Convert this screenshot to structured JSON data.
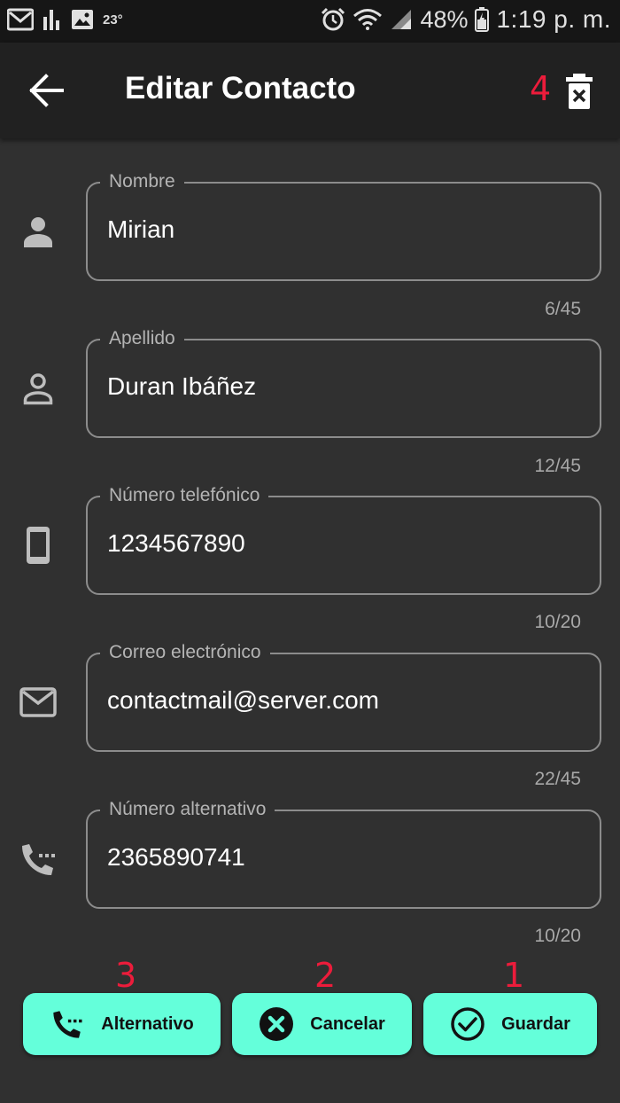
{
  "status_bar": {
    "temperature": "23°",
    "battery": "48%",
    "time": "1:19 p. m."
  },
  "app_bar": {
    "title": "Editar Contacto",
    "delete_annotation": "4"
  },
  "fields": [
    {
      "icon": "person-icon",
      "label": "Nombre",
      "value": "Mirian",
      "counter": "6/45"
    },
    {
      "icon": "person-outline-icon",
      "label": "Apellido",
      "value": "Duran Ibáñez",
      "counter": "12/45"
    },
    {
      "icon": "smartphone-icon",
      "label": "Número telefónico",
      "value": "1234567890",
      "counter": "10/20"
    },
    {
      "icon": "mail-icon",
      "label": "Correo electrónico",
      "value": "contactmail@server.com",
      "counter": "22/45"
    },
    {
      "icon": "dialpad-phone-icon",
      "label": "Número alternativo",
      "value": "2365890741",
      "counter": "10/20"
    }
  ],
  "actions": {
    "alternativo": {
      "label": "Alternativo",
      "annotation": "3"
    },
    "cancelar": {
      "label": "Cancelar",
      "annotation": "2"
    },
    "guardar": {
      "label": "Guardar",
      "annotation": "1"
    }
  },
  "colors": {
    "accent": "#64ffda",
    "annotation": "#ec1c3b",
    "background": "#303030",
    "app_bar": "#212121"
  }
}
